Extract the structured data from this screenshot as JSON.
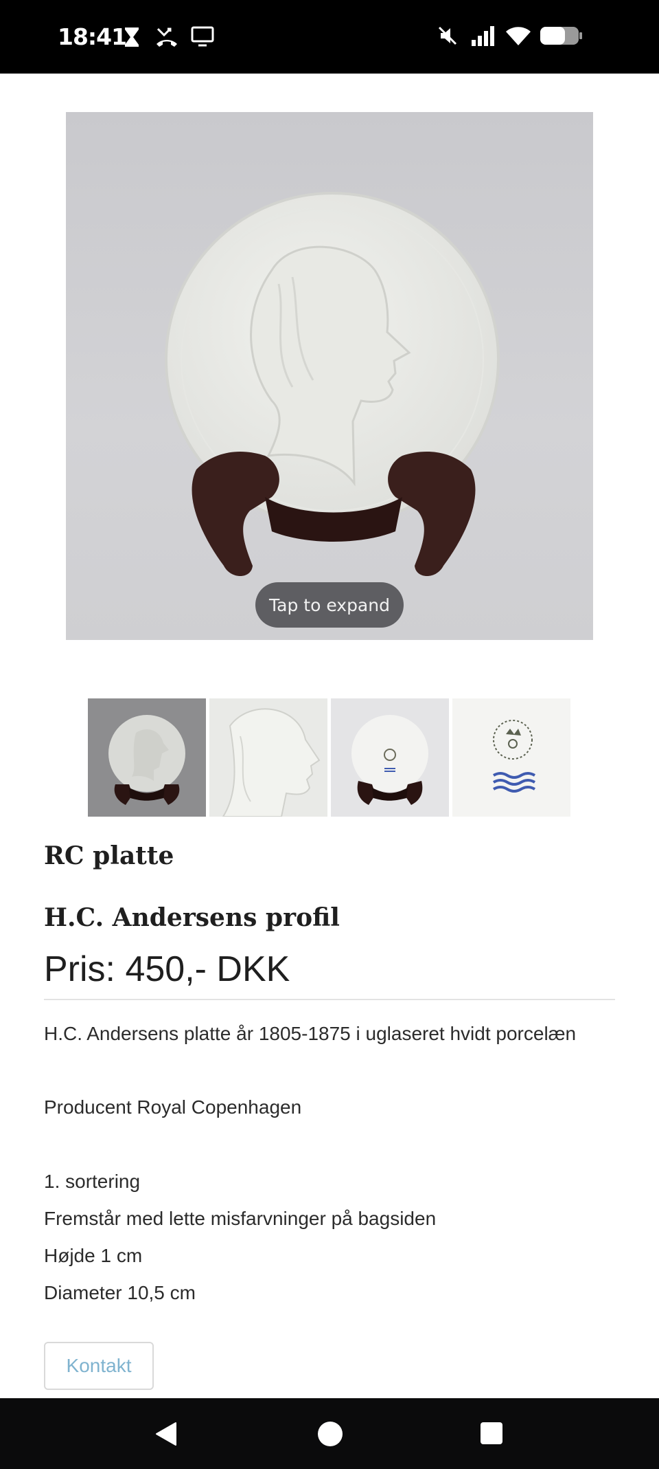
{
  "status_bar": {
    "time": "18:41",
    "left_icons": [
      "hourglass-icon",
      "missed-call-icon",
      "screen-cast-icon"
    ],
    "right_icons": [
      "mute-icon",
      "signal-icon",
      "wifi-icon",
      "battery-icon"
    ]
  },
  "product_image": {
    "tap_label": "Tap to expand"
  },
  "thumbnails": [
    "thumb-front-gray",
    "thumb-profile-closeup",
    "thumb-back",
    "thumb-hallmark"
  ],
  "product": {
    "category": "RC platte",
    "title": "H.C. Andersens profil",
    "price": "Pris: 450,- DKK",
    "description": [
      "H.C. Andersens platte år 1805-1875 i uglaseret hvidt porcelæn",
      "Producent Royal Copenhagen",
      "1. sortering",
      "Fremstår med lette misfarvninger på bagsiden",
      "Højde 1 cm",
      "Diameter 10,5 cm"
    ],
    "contact_label": "Kontakt"
  },
  "nav_bar": {
    "icons": [
      "back-icon",
      "home-icon",
      "recents-icon"
    ]
  }
}
